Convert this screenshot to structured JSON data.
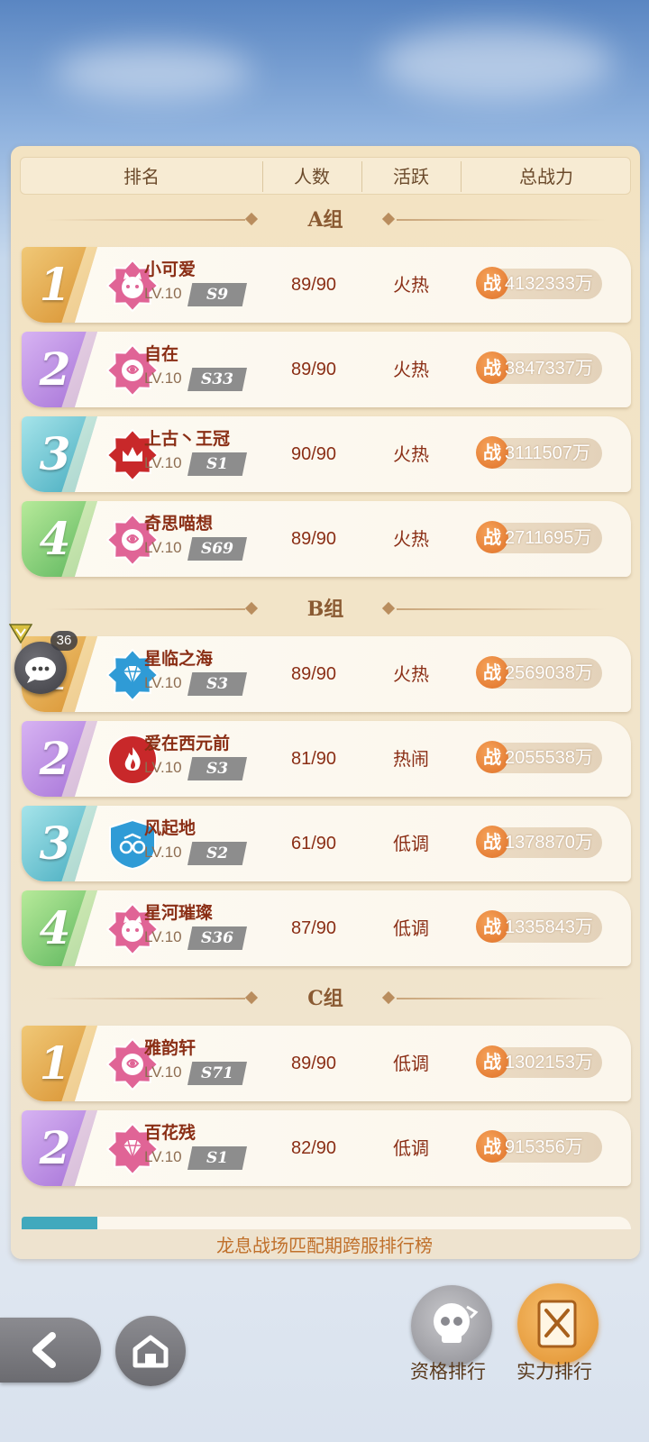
{
  "header": {
    "col_rank": "排名",
    "col_members": "人数",
    "col_active": "活跃",
    "col_power": "总战力"
  },
  "power_badge": "战",
  "groups": [
    {
      "title": "A组",
      "rows": [
        {
          "rank": "1",
          "color": "gold",
          "emblem": "cat-badge-icon",
          "emblem_color": "#e06496",
          "name": "小可爱",
          "level": "LV.10",
          "server": "S9",
          "members": "89/90",
          "active": "火热",
          "power": "4132333万"
        },
        {
          "rank": "2",
          "color": "purple",
          "emblem": "rose-badge-icon",
          "emblem_color": "#e06496",
          "name": "自在",
          "level": "LV.10",
          "server": "S33",
          "members": "89/90",
          "active": "火热",
          "power": "3847337万"
        },
        {
          "rank": "3",
          "color": "teal",
          "emblem": "crown-badge-icon",
          "emblem_color": "#c8282a",
          "name": "上古丶王冠",
          "level": "LV.10",
          "server": "S1",
          "members": "90/90",
          "active": "火热",
          "power": "3111507万"
        },
        {
          "rank": "4",
          "color": "green",
          "emblem": "rose-badge-icon",
          "emblem_color": "#e06496",
          "name": "奇思喵想",
          "level": "LV.10",
          "server": "S69",
          "members": "89/90",
          "active": "火热",
          "power": "2711695万"
        }
      ]
    },
    {
      "title": "B组",
      "rows": [
        {
          "rank": "1",
          "color": "gold",
          "emblem": "diamond-badge-icon",
          "emblem_color": "#2f9bd6",
          "name": "星临之海",
          "level": "LV.10",
          "server": "S3",
          "members": "89/90",
          "active": "火热",
          "power": "2569038万"
        },
        {
          "rank": "2",
          "color": "purple",
          "emblem": "flame-badge-icon",
          "emblem_color": "#c8282a",
          "name": "爱在西元前",
          "level": "LV.10",
          "server": "S3",
          "members": "81/90",
          "active": "热闹",
          "power": "2055538万"
        },
        {
          "rank": "3",
          "color": "teal",
          "emblem": "shield-badge-icon",
          "emblem_color": "#2f9bd6",
          "name": "风起地",
          "level": "LV.10",
          "server": "S2",
          "members": "61/90",
          "active": "低调",
          "power": "1378870万"
        },
        {
          "rank": "4",
          "color": "green",
          "emblem": "cat-badge-icon",
          "emblem_color": "#e06496",
          "name": "星河璀璨",
          "level": "LV.10",
          "server": "S36",
          "members": "87/90",
          "active": "低调",
          "power": "1335843万"
        }
      ]
    },
    {
      "title": "C组",
      "rows": [
        {
          "rank": "1",
          "color": "gold",
          "emblem": "rose-badge-icon",
          "emblem_color": "#e06496",
          "name": "雅韵轩",
          "level": "LV.10",
          "server": "S71",
          "members": "89/90",
          "active": "低调",
          "power": "1302153万"
        },
        {
          "rank": "2",
          "color": "purple",
          "emblem": "diamond-badge-icon",
          "emblem_color": "#e06496",
          "name": "百花残",
          "level": "LV.10",
          "server": "S1",
          "members": "82/90",
          "active": "低调",
          "power": "915356万"
        }
      ]
    }
  ],
  "footer": {
    "title": "龙息战场匹配期跨服排行榜"
  },
  "chat": {
    "badge": "36"
  },
  "tabs": {
    "qualification": "资格排行",
    "strength": "实力排行"
  },
  "colors": {
    "gold": "#d8902e",
    "purple": "#a36fd6",
    "teal": "#41a9bd",
    "green": "#58b35a",
    "text_dark_red": "#8a2e15",
    "accent_orange": "#e07128"
  }
}
